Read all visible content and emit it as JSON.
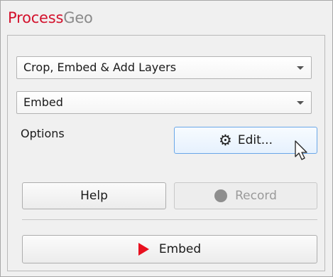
{
  "app": {
    "title_part1": "Process",
    "title_part2": "Geo",
    "brand_color": "#d3122d"
  },
  "selectors": {
    "workflow": "Crop, Embed & Add Layers",
    "action": "Embed"
  },
  "options": {
    "label": "Options",
    "edit_label": "Edit..."
  },
  "buttons": {
    "help_label": "Help",
    "record_label": "Record",
    "run_label": "Embed"
  },
  "icons": {
    "edit": "gear-icon",
    "record": "record-dot-icon",
    "run": "play-icon",
    "dropdown": "chevron-down-icon"
  }
}
